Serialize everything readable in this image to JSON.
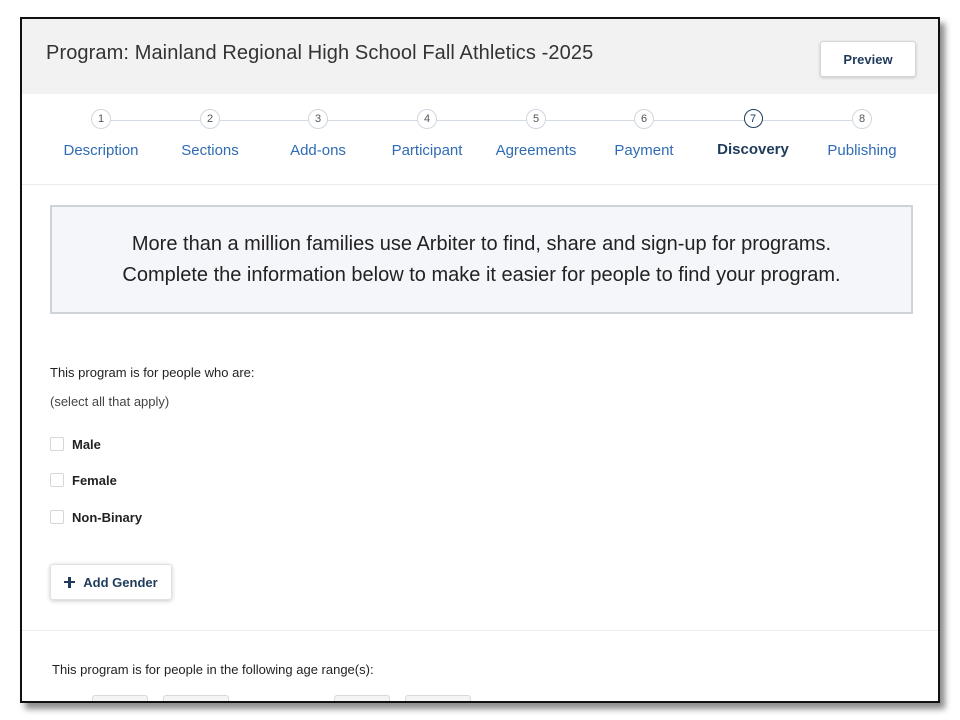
{
  "header": {
    "title": "Program: Mainland Regional High School Fall Athletics -2025",
    "preview_label": "Preview"
  },
  "steps": [
    {
      "number": "1",
      "label": "Description"
    },
    {
      "number": "2",
      "label": "Sections"
    },
    {
      "number": "3",
      "label": "Add-ons"
    },
    {
      "number": "4",
      "label": "Participant"
    },
    {
      "number": "5",
      "label": "Agreements"
    },
    {
      "number": "6",
      "label": "Payment"
    },
    {
      "number": "7",
      "label": "Discovery",
      "active": true
    },
    {
      "number": "8",
      "label": "Publishing"
    }
  ],
  "banner": {
    "line1": "More than a million families use Arbiter to find, share and sign-up for programs.",
    "line2": "Complete the information below to make it easier for people to find your program."
  },
  "gender_section": {
    "title": "This program is for people who are:",
    "hint": "(select all that apply)",
    "options": [
      {
        "label": "Male",
        "checked": false
      },
      {
        "label": "Female",
        "checked": false
      },
      {
        "label": "Non-Binary",
        "checked": false
      }
    ],
    "add_button_label": "Add Gender"
  },
  "age_section": {
    "title": "This program is for people in the following age range(s):"
  },
  "colors": {
    "accent_navy": "#1f3b5b",
    "link_blue": "#2f6cb3",
    "header_bg": "#f2f2f2",
    "banner_bg": "#f4f6fa"
  }
}
